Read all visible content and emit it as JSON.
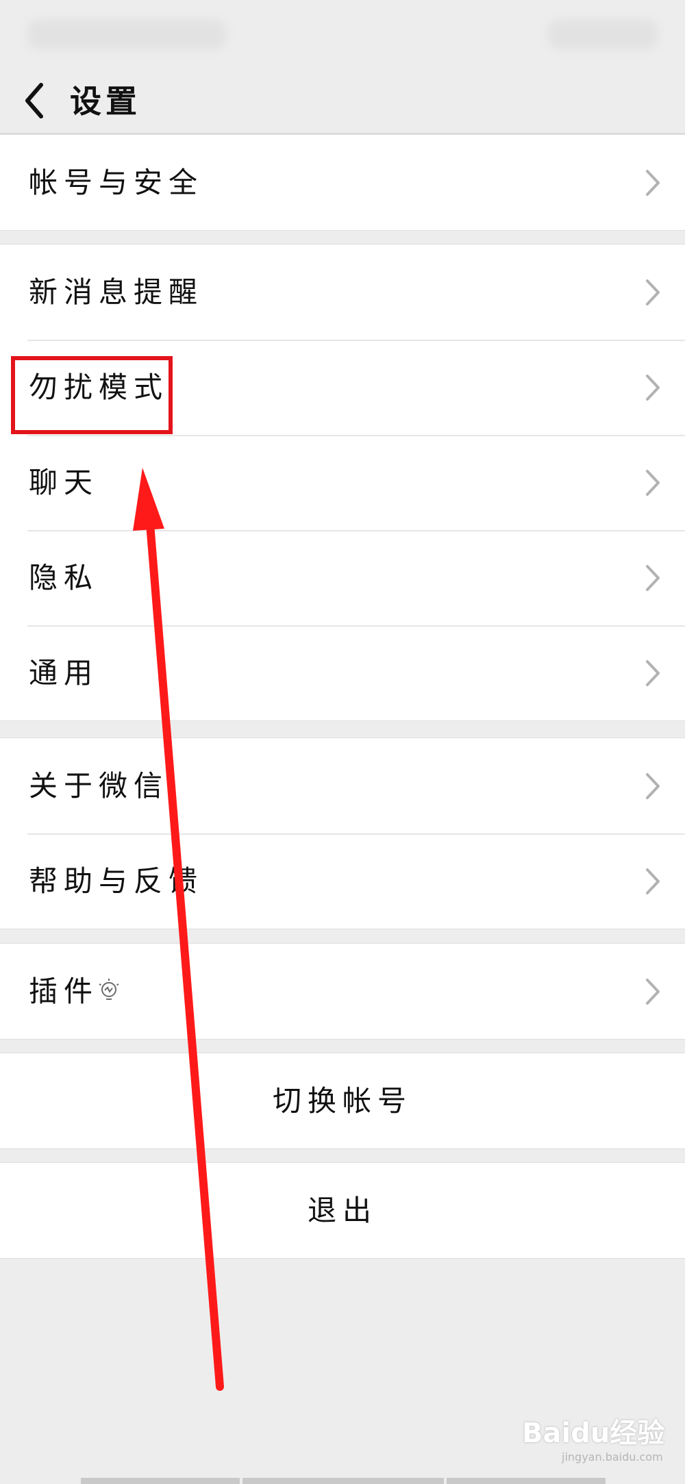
{
  "nav": {
    "title": "设置"
  },
  "groups": [
    {
      "items": [
        {
          "label": "帐号与安全"
        }
      ]
    },
    {
      "items": [
        {
          "label": "新消息提醒"
        },
        {
          "label": "勿扰模式"
        },
        {
          "label": "聊天"
        },
        {
          "label": "隐私"
        },
        {
          "label": "通用"
        }
      ]
    },
    {
      "items": [
        {
          "label": "关于微信"
        },
        {
          "label": "帮助与反馈"
        }
      ]
    },
    {
      "items": [
        {
          "label": "插件"
        }
      ]
    }
  ],
  "actions": {
    "switch_account": "切换帐号",
    "logout": "退出"
  },
  "icons": {
    "back": "chevron-left-icon",
    "chevron": "chevron-right-icon",
    "plugin": "lightbulb-icon"
  },
  "annotation": {
    "highlight_color": "#e3141b",
    "arrow_color": "#ff1a1a"
  },
  "watermark": {
    "brand": "Baidu经验",
    "url": "jingyan.baidu.com"
  }
}
